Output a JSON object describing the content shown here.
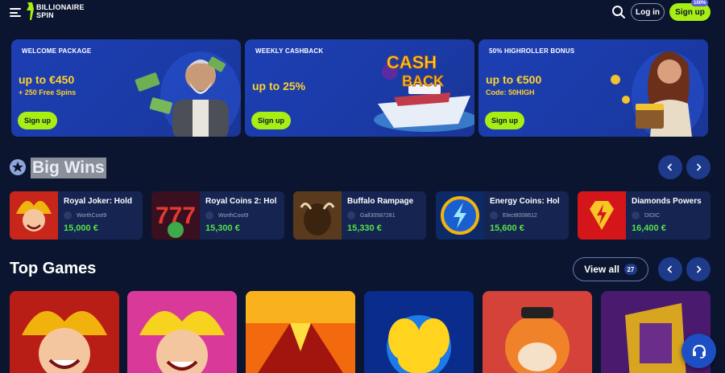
{
  "header": {
    "logo_line1": "BILLIONAIRE",
    "logo_line2": "SPIN",
    "login_label": "Log in",
    "signup_label": "Sign up",
    "signup_badge": "100%",
    "icons": [
      "menu-icon",
      "search-icon"
    ]
  },
  "promos": [
    {
      "tag": "WELCOME PACKAGE",
      "headline": "up to €450",
      "sub": "+ 250 Free Spins",
      "cta": "Sign up"
    },
    {
      "tag": "WEEKLY CASHBACK",
      "headline": "up to 25%",
      "sub": "",
      "cta": "Sign up",
      "art_text1": "CASH",
      "art_text2": "BACK"
    },
    {
      "tag": "50% HIGHROLLER BONUS",
      "headline": "up to €500",
      "sub": "Code: 50HIGH",
      "cta": "Sign up"
    }
  ],
  "big_wins": {
    "title": "Big Wins",
    "items": [
      {
        "game": "Royal Joker: Hold",
        "user": "WorthCoot9",
        "amount": "15,000 €"
      },
      {
        "game": "Royal Coins 2: Hol",
        "user": "WorthCoot9",
        "amount": "15,300 €"
      },
      {
        "game": "Buffalo Rampage",
        "user": "Gall30587281",
        "amount": "15,330 €"
      },
      {
        "game": "Energy Coins: Hol",
        "user": "Elect8008612",
        "amount": "15,600 €"
      },
      {
        "game": "Diamonds Powers",
        "user": "DIDIC",
        "amount": "16,400 €"
      }
    ]
  },
  "top_games": {
    "title": "Top Games",
    "view_all_label": "View all",
    "view_all_count": "27"
  },
  "colors": {
    "background": "#0b1530",
    "accent_green": "#a6ee13",
    "promo_yellow": "#ffd22a",
    "win_green": "#55e34a",
    "card_blue": "#1d3fb3"
  }
}
